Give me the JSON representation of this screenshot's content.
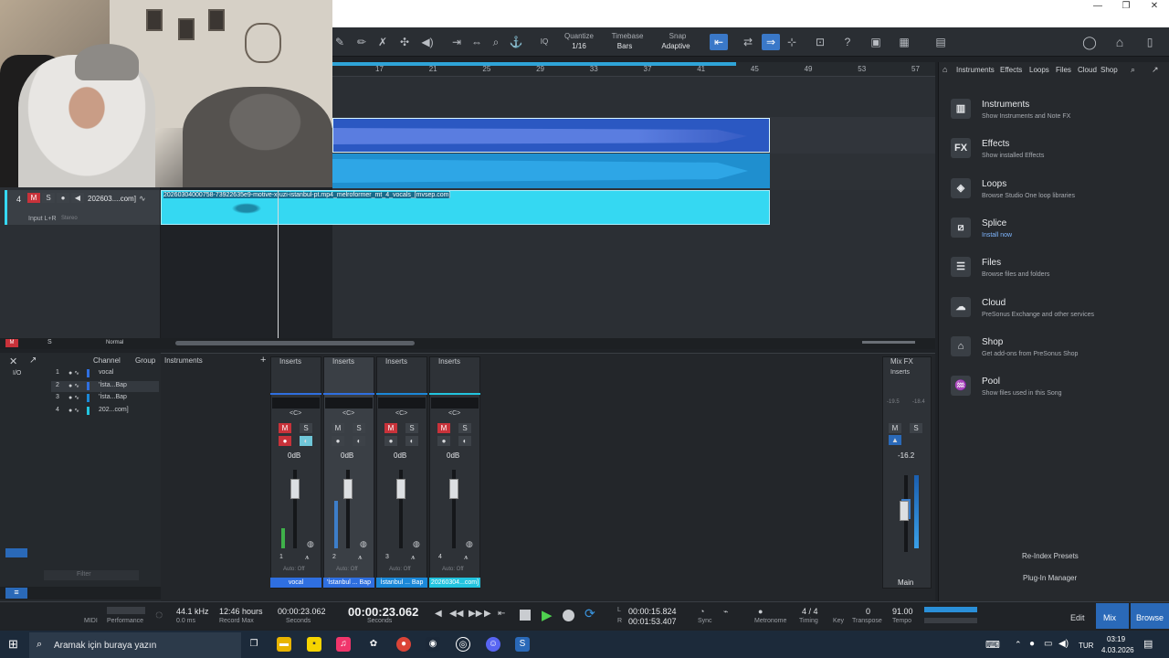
{
  "toolbar": {
    "quantize_label": "Quantize",
    "quantize_value": "1/16",
    "timebase_label": "Timebase",
    "timebase_value": "Bars",
    "snap_label": "Snap",
    "snap_value": "Adaptive",
    "iq": "IQ"
  },
  "ruler": [
    "17",
    "21",
    "25",
    "29",
    "33",
    "37",
    "41",
    "45",
    "49",
    "53",
    "57"
  ],
  "track": {
    "number": "4",
    "mute": "M",
    "solo": "S",
    "name": "202603....com]",
    "input": "Input L+R",
    "stereo": "Stereo",
    "clip_name": "20260304000758-73922635e9-motive-x-uzi-istanbul-pt.mp4_melroformer_mt_4_vocals_[mvsep.com]"
  },
  "arrange_footer": {
    "m": "M",
    "s": "S",
    "mode": "Normal"
  },
  "browser": {
    "tabs": [
      "Instruments",
      "Effects",
      "Loops",
      "Files",
      "Cloud",
      "Shop"
    ],
    "items": [
      {
        "icon": "piano-icon",
        "glyph": "▥",
        "title": "Instruments",
        "sub": "Show Instruments and Note FX"
      },
      {
        "icon": "fx-icon",
        "glyph": "FX",
        "title": "Effects",
        "sub": "Show installed Effects"
      },
      {
        "icon": "loops-icon",
        "glyph": "◈",
        "title": "Loops",
        "sub": "Browse Studio One loop libraries"
      },
      {
        "icon": "splice-icon",
        "glyph": "⧄",
        "title": "Splice",
        "sub": "Install now"
      },
      {
        "icon": "files-icon",
        "glyph": "☰",
        "title": "Files",
        "sub": "Browse files and folders"
      },
      {
        "icon": "cloud-icon",
        "glyph": "☁",
        "title": "Cloud",
        "sub": "PreSonus Exchange and other services"
      },
      {
        "icon": "shop-icon",
        "glyph": "⌂",
        "title": "Shop",
        "sub": "Get add-ons from PreSonus Shop"
      },
      {
        "icon": "pool-icon",
        "glyph": "♒",
        "title": "Pool",
        "sub": "Show files used in this Song"
      }
    ],
    "reindex": "Re-Index Presets",
    "plugin_manager": "Plug-In Manager"
  },
  "mixer_list": {
    "header_channel": "Channel",
    "header_group": "Group",
    "header_instruments": "Instruments",
    "io": "I/O",
    "rows": [
      {
        "num": "1",
        "name": "vocal"
      },
      {
        "num": "2",
        "name": "'İsta...Bap"
      },
      {
        "num": "3",
        "name": "'İsta...Bap"
      },
      {
        "num": "4",
        "name": "202...com]"
      }
    ],
    "filter": "Filter"
  },
  "strips": [
    {
      "num": "1",
      "name": "vocal",
      "color": "#2f6fe0",
      "db": "0dB",
      "auto": "Auto: Off",
      "pan": "<C>",
      "level": 0.25
    },
    {
      "num": "2",
      "name": "'İstanbul ... Bap",
      "color": "#2f6fe0",
      "db": "0dB",
      "auto": "Auto: Off",
      "pan": "<C>",
      "level": 0.6
    },
    {
      "num": "3",
      "name": "İstanbul ... Bap",
      "color": "#1b88d8",
      "db": "0dB",
      "auto": "Auto: Off",
      "pan": "<C>",
      "level": 0
    },
    {
      "num": "4",
      "name": "20260304...com]",
      "color": "#22c4df",
      "db": "0dB",
      "auto": "Auto: Off",
      "pan": "<C>",
      "level": 0
    }
  ],
  "strip_common": {
    "inserts": "Inserts",
    "m": "M",
    "s": "S"
  },
  "main": {
    "mixfx": "Mix FX",
    "inserts": "Inserts",
    "db": "-16.2",
    "name": "Main",
    "peak_l": "-19.5",
    "peak_r": "-18.4"
  },
  "transport": {
    "midi": "MIDI",
    "performance": "Performance",
    "samplerate": "44.1 kHz",
    "latency": "0.0 ms",
    "record_max_val": "12:46 hours",
    "record_max": "Record Max",
    "seconds_small": "00:00:23.062",
    "seconds_label": "Seconds",
    "time_big": "00:00:23.062",
    "time_big_label": "Seconds",
    "loop_l": "00:00:15.824",
    "loop_r": "00:01:53.407",
    "l": "L",
    "r": "R",
    "sync": "Sync",
    "metronome": "Metronome",
    "timing": "Timing",
    "sig": "4 / 4",
    "key": "Key",
    "transpose_val": "0",
    "transpose": "Transpose",
    "tempo_val": "91.00",
    "tempo": "Tempo",
    "edit": "Edit",
    "mix": "Mix",
    "browse": "Browse"
  },
  "taskbar": {
    "search": "Aramak için buraya yazın",
    "lang": "TUR",
    "time": "03:19",
    "date": "4.03.2026"
  }
}
